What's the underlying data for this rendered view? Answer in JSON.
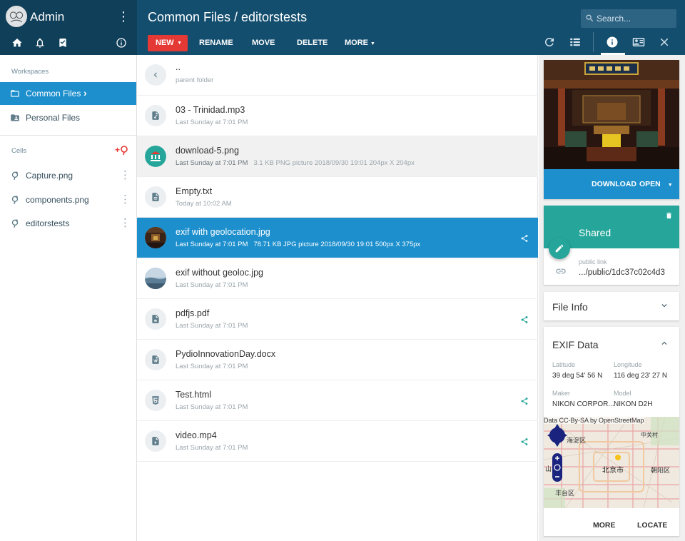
{
  "user": {
    "name": "Admin"
  },
  "header": {
    "path_title": "Common Files / editorstests",
    "search_placeholder": "Search..."
  },
  "toolbar": {
    "new_label": "NEW",
    "rename_label": "RENAME",
    "move_label": "MOVE",
    "delete_label": "DELETE",
    "more_label": "MORE"
  },
  "sidebar": {
    "workspaces_label": "Workspaces",
    "workspaces": [
      {
        "label": "Common Files",
        "icon": "folder-open-icon",
        "active": true
      },
      {
        "label": "Personal Files",
        "icon": "folder-account-icon",
        "active": false
      }
    ],
    "cells_label": "Cells",
    "cells": [
      {
        "label": "Capture.png"
      },
      {
        "label": "components.png"
      },
      {
        "label": "editorstests"
      }
    ]
  },
  "files": [
    {
      "name": "..",
      "meta": "parent folder",
      "icon": "chevron-left-icon"
    },
    {
      "name": "03 - Trinidad.mp3",
      "meta": "Last Sunday at 7:01 PM",
      "icon": "music-file-icon"
    },
    {
      "name": "download-5.png",
      "meta": "Last Sunday at 7:01 PM",
      "details": "3.1 KB   PNG picture   2018/09/30 19:01   204px X 204px",
      "icon": "bank-thumb-icon"
    },
    {
      "name": "Empty.txt",
      "meta": "Today at 10:02 AM",
      "icon": "text-file-icon"
    },
    {
      "name": "exif with geolocation.jpg",
      "meta": "Last Sunday at 7:01 PM",
      "details": "78.71 KB   JPG picture   2018/09/30 19:01   500px X 375px",
      "icon": "palace-thumb-icon"
    },
    {
      "name": "exif without geoloc.jpg",
      "meta": "Last Sunday at 7:01 PM",
      "icon": "landscape-thumb-icon"
    },
    {
      "name": "pdfjs.pdf",
      "meta": "Last Sunday at 7:01 PM",
      "icon": "pdf-file-icon"
    },
    {
      "name": "PydioInnovationDay.docx",
      "meta": "Last Sunday at 7:01 PM",
      "icon": "word-file-icon"
    },
    {
      "name": "Test.html",
      "meta": "Last Sunday at 7:01 PM",
      "icon": "html5-file-icon"
    },
    {
      "name": "video.mp4",
      "meta": "Last Sunday at 7:01 PM",
      "icon": "video-file-icon"
    }
  ],
  "preview": {
    "download_label": "DOWNLOAD",
    "open_label": "OPEN"
  },
  "shared": {
    "title": "Shared",
    "public_link_label": "public link",
    "public_link_value": ".../public/1dc37c02c4d3"
  },
  "file_info": {
    "title": "File Info"
  },
  "exif": {
    "title": "EXIF Data",
    "latitude_label": "Latitude",
    "latitude_value": "39 deg 54' 56 N",
    "longitude_label": "Longitude",
    "longitude_value": "116 deg 23' 27 N",
    "maker_label": "Maker",
    "maker_value": "NIKON CORPOR...",
    "model_label": "Model",
    "model_value": "NIKON D2H",
    "map_attribution": "Data CC-By-SA by OpenStreetMap",
    "map_labels": [
      "海淀区",
      "北京市",
      "丰台区",
      "山",
      "朝阳区",
      "中关村"
    ],
    "more_label": "MORE",
    "locate_label": "LOCATE"
  },
  "colors": {
    "header": "#134e6f",
    "accent_blue": "#1d8fcd",
    "teal": "#26a69a",
    "new_button": "#e53935"
  }
}
